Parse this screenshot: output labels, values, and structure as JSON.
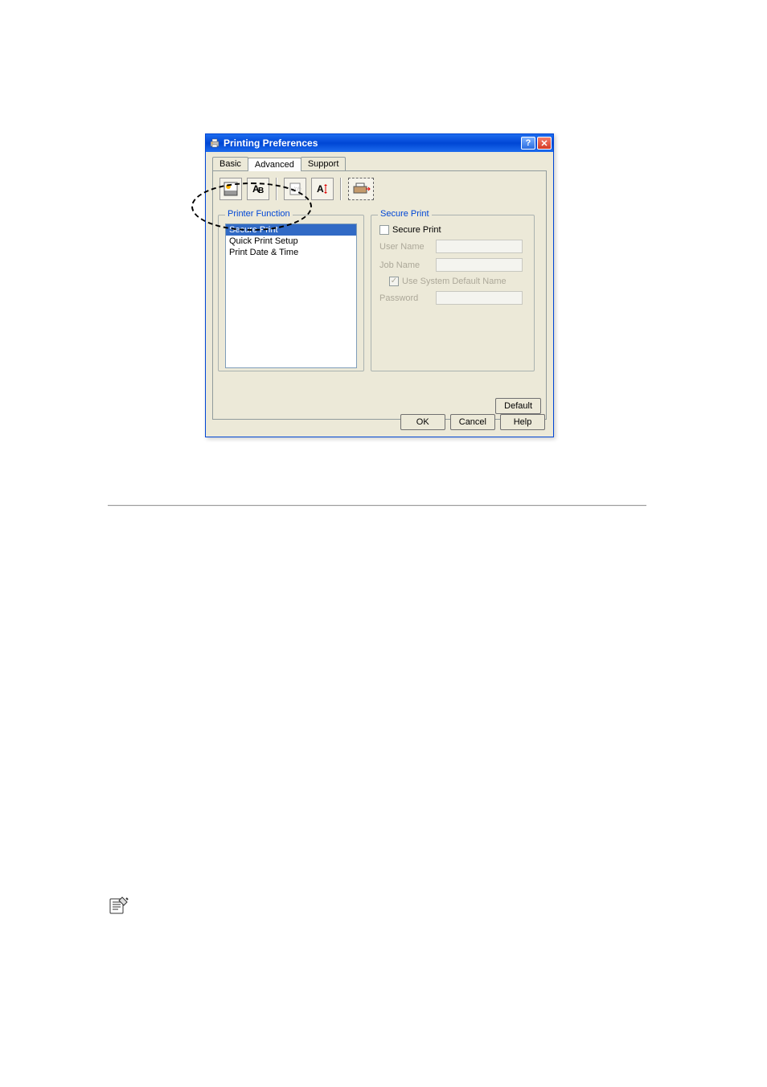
{
  "dialog": {
    "title": "Printing Preferences"
  },
  "tabs": {
    "basic": "Basic",
    "advanced": "Advanced",
    "support": "Support"
  },
  "printer_function": {
    "legend": "Printer Function",
    "items": {
      "secure_print": "Secure Print",
      "quick_print_setup": "Quick Print Setup",
      "print_date_time": "Print Date & Time"
    }
  },
  "secure_print_panel": {
    "legend": "Secure Print",
    "secure_print_checkbox": "Secure Print",
    "user_name_label": "User Name",
    "job_name_label": "Job Name",
    "use_system_default_name": "Use System Default Name",
    "password_label": "Password"
  },
  "buttons": {
    "default": "Default",
    "ok": "OK",
    "cancel": "Cancel",
    "help": "Help"
  }
}
